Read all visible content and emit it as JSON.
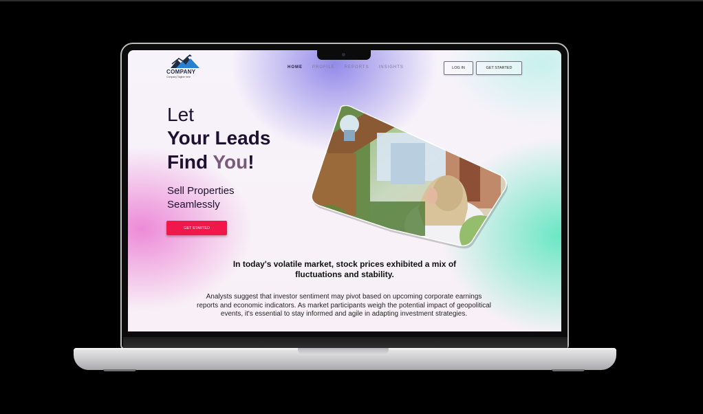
{
  "brand": {
    "name": "COMPANY",
    "tagline": "Company Tagline here",
    "colors": {
      "accent": "#f0174a",
      "logo_dark": "#1f2b3f",
      "logo_blue": "#2a7fd0"
    }
  },
  "nav": {
    "items": [
      {
        "label": "HOME",
        "active": true
      },
      {
        "label": "PROFILE",
        "active": false
      },
      {
        "label": "REPORTS",
        "active": false
      },
      {
        "label": "INSIGHTS",
        "active": false
      }
    ],
    "login_label": "LOG IN",
    "get_started_label": "GET STARTED"
  },
  "hero": {
    "line1": "Let",
    "line2": "Your Leads",
    "line3_a": "Find ",
    "line3_b": "You",
    "line3_c": "!",
    "subtitle_1": "Sell Properties",
    "subtitle_2": "Seamlessly",
    "cta_label": "GET STARTED"
  },
  "content": {
    "headline": "In today's volatile market, stock prices exhibited a mix of fluctuations and stability.",
    "paragraph": "Analysts suggest that investor sentiment may pivot based on upcoming corporate earnings reports and economic indicators. As market participants weigh the potential impact of geopolitical events, it's essential to stay informed and agile in adapting investment strategies."
  },
  "icons": {
    "logo": "mountain-logo-icon",
    "photo": "hero-photo-image"
  }
}
